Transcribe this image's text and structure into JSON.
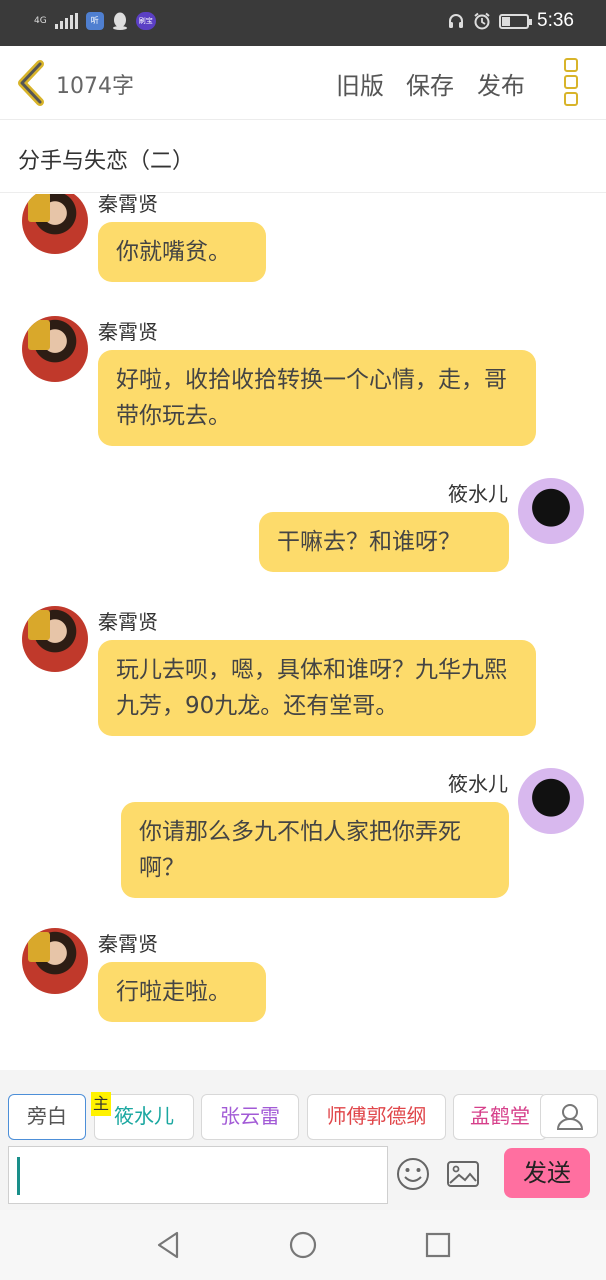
{
  "status_bar": {
    "network_label": "4G",
    "app_badge": "听",
    "purple_badge": "刷宝",
    "time": "5:36",
    "battery_level": 0.3
  },
  "header": {
    "word_count": "1074字",
    "old_version": "旧版",
    "save": "保存",
    "publish": "发布"
  },
  "title": "分手与失恋（二）",
  "messages": [
    {
      "sender": "秦霄贤",
      "side": "left",
      "text": "你就嘴贫。"
    },
    {
      "sender": "秦霄贤",
      "side": "left",
      "text": "好啦，收拾收拾转换一个心情，走，哥带你玩去。"
    },
    {
      "sender": "筱水儿",
      "side": "right",
      "text": "干嘛去？和谁呀？"
    },
    {
      "sender": "秦霄贤",
      "side": "left",
      "text": "玩儿去呗，嗯，具体和谁呀？九华九熙九芳，90九龙。还有堂哥。"
    },
    {
      "sender": "筱水儿",
      "side": "right",
      "text": "你请那么多九不怕人家把你弄死啊？"
    },
    {
      "sender": "秦霄贤",
      "side": "left",
      "text": "行啦走啦。"
    }
  ],
  "roles": [
    {
      "label": "旁白",
      "color": "#555555",
      "active": true
    },
    {
      "label": "筱水儿",
      "color": "#1aa7a0",
      "active": false
    },
    {
      "label": "张云雷",
      "color": "#a25ad6",
      "active": false
    },
    {
      "label": "师傅郭德纲",
      "color": "#e0464a",
      "active": false
    },
    {
      "label": "孟鹤堂",
      "color": "#d63f8a",
      "active": false
    }
  ],
  "main_role_tag": "主",
  "input": {
    "value": "",
    "placeholder": ""
  },
  "send_label": "发送",
  "icons": [
    "back-chevron-icon",
    "more-menu-icon",
    "user-icon",
    "emoji-icon",
    "image-icon",
    "nav-back-icon",
    "nav-home-icon",
    "nav-recent-icon"
  ]
}
